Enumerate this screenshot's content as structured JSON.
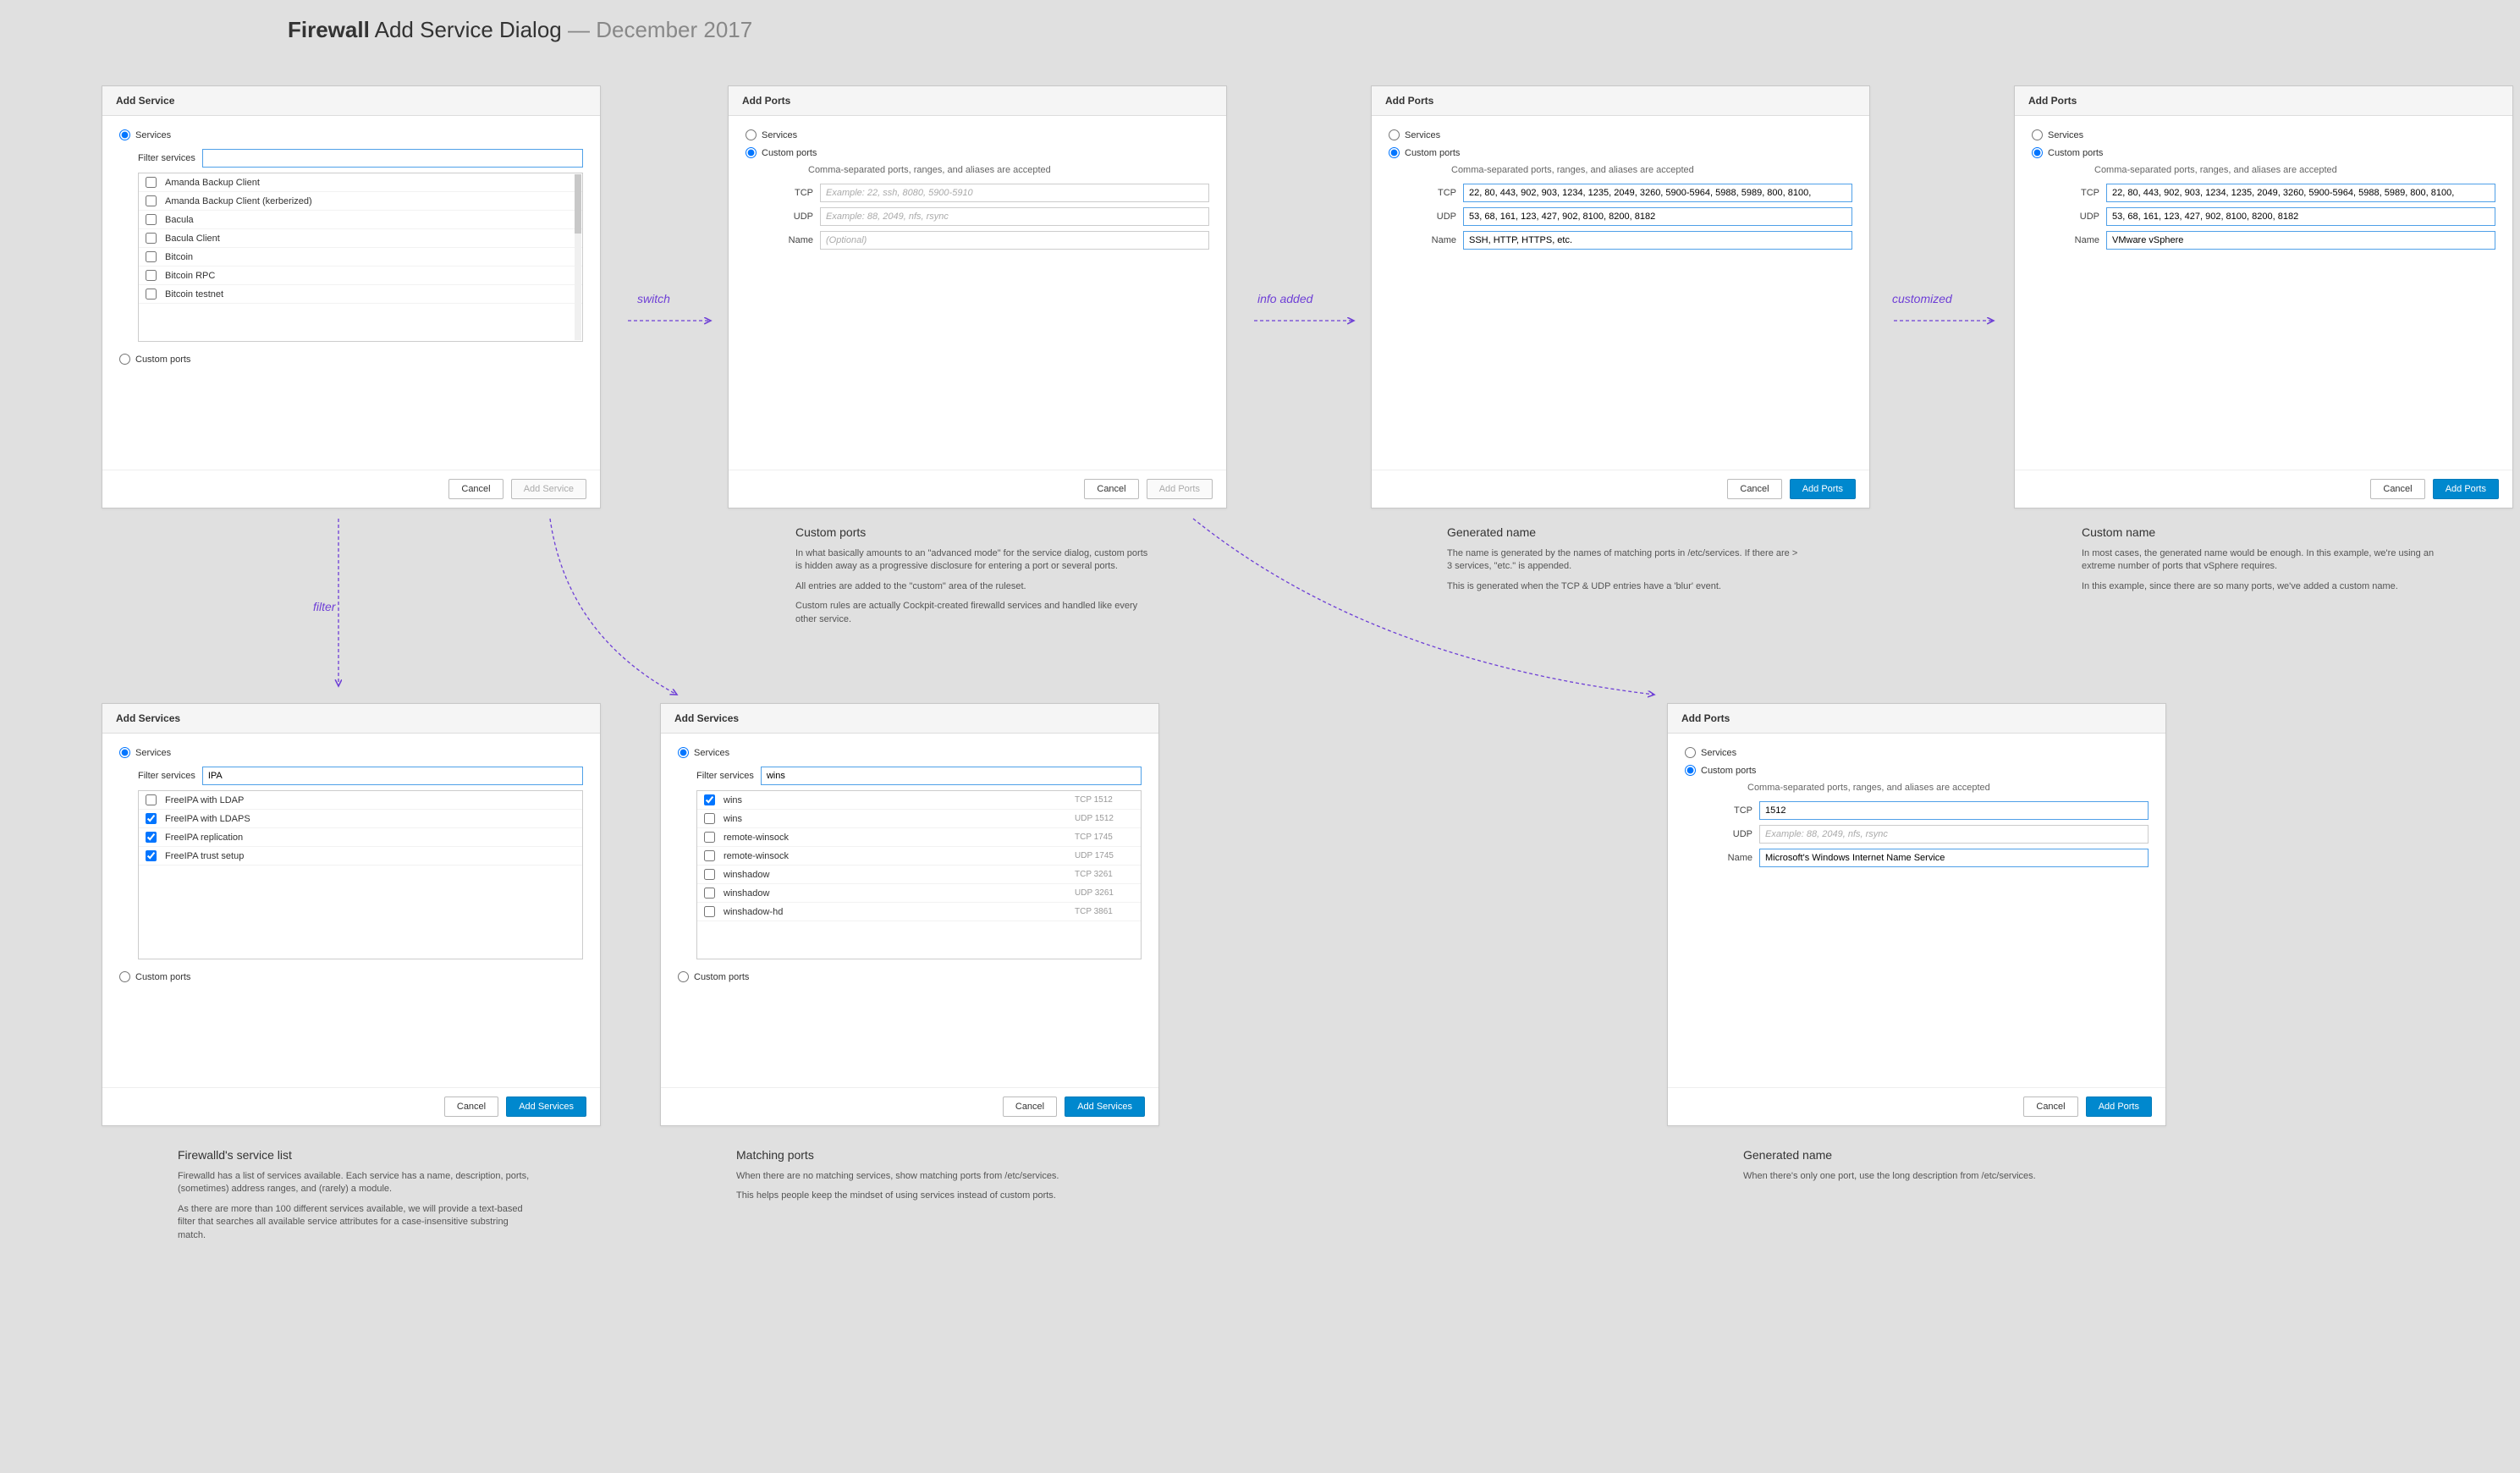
{
  "title_bold": "Firewall",
  "title_rest": "Add Service Dialog",
  "title_date": "December 2017",
  "annotations": {
    "switch": "switch",
    "info_added": "info added",
    "customized": "customized",
    "filter": "filter"
  },
  "labels": {
    "services": "Services",
    "custom_ports": "Custom ports",
    "filter_services": "Filter services",
    "cancel": "Cancel",
    "add_service": "Add Service",
    "add_services": "Add Services",
    "add_ports": "Add Ports",
    "tcp": "TCP",
    "udp": "UDP",
    "name": "Name",
    "ports_hint": "Comma-separated ports, ranges, and aliases are accepted",
    "tcp_ph": "Example: 22, ssh, 8080, 5900-5910",
    "udp_ph": "Example: 88, 2049, nfs, rsync",
    "name_ph": "(Optional)"
  },
  "d1": {
    "title": "Add Service",
    "filter_val": "",
    "items": [
      "Amanda Backup Client",
      "Amanda Backup Client (kerberized)",
      "Bacula",
      "Bacula Client",
      "Bitcoin",
      "Bitcoin RPC",
      "Bitcoin testnet"
    ]
  },
  "d2": {
    "title": "Add Ports",
    "tcp": "",
    "udp": "",
    "name": ""
  },
  "d3": {
    "title": "Add Ports",
    "tcp": "22, 80, 443, 902, 903, 1234, 1235, 2049, 3260, 5900-5964, 5988, 5989, 800, 8100,",
    "udp": "53, 68, 161, 123, 427, 902, 8100, 8200, 8182",
    "name": "SSH, HTTP, HTTPS, etc."
  },
  "d4": {
    "title": "Add Ports",
    "tcp": "22, 80, 443, 902, 903, 1234, 1235, 2049, 3260, 5900-5964, 5988, 5989, 800, 8100,",
    "udp": "53, 68, 161, 123, 427, 902, 8100, 8200, 8182",
    "name": "VMware vSphere"
  },
  "d5": {
    "title": "Add Services",
    "filter_val": "IPA",
    "items": [
      {
        "label": "FreeIPA with LDAP",
        "checked": false
      },
      {
        "label": "FreeIPA with LDAPS",
        "checked": true
      },
      {
        "label": "FreeIPA replication",
        "checked": true
      },
      {
        "label": "FreeIPA trust setup",
        "checked": true
      }
    ]
  },
  "d6": {
    "title": "Add Services",
    "filter_val": "wins",
    "items": [
      {
        "label": "wins",
        "port": "TCP  1512",
        "checked": true
      },
      {
        "label": "wins",
        "port": "UDP 1512",
        "checked": false
      },
      {
        "label": "remote-winsock",
        "port": "TCP  1745",
        "checked": false
      },
      {
        "label": "remote-winsock",
        "port": "UDP 1745",
        "checked": false
      },
      {
        "label": "winshadow",
        "port": "TCP  3261",
        "checked": false
      },
      {
        "label": "winshadow",
        "port": "UDP 3261",
        "checked": false
      },
      {
        "label": "winshadow-hd",
        "port": "TCP  3861",
        "checked": false
      }
    ]
  },
  "d7": {
    "title": "Add Ports",
    "tcp": "1512",
    "udp": "",
    "name": "Microsoft's Windows Internet Name Service"
  },
  "captions": {
    "c2": {
      "h": "Custom ports",
      "p": [
        "In what basically amounts to an \"advanced mode\" for the service dialog, custom ports is hidden away as a progressive disclosure for entering a port or several ports.",
        "All entries are added to the \"custom\" area of the ruleset.",
        "Custom rules are actually Cockpit-created firewalld services and handled like every other service."
      ]
    },
    "c3": {
      "h": "Generated name",
      "p": [
        "The name is generated by the names of matching ports in /etc/services. If there are > 3 services, \"etc.\" is appended.",
        "This is generated when the TCP & UDP entries have a 'blur' event."
      ]
    },
    "c4": {
      "h": "Custom name",
      "p": [
        "In most cases, the generated name would be enough. In this example, we're using an extreme number of ports that vSphere requires.",
        "In this example, since there are so many ports, we've added a custom name."
      ]
    },
    "c5": {
      "h": "Firewalld's service list",
      "p": [
        "Firewalld has a list of services available. Each service has a name, description, ports, (sometimes) address ranges, and (rarely) a module.",
        "As there are more than 100 different services available, we will provide a text-based filter that searches all available service attributes for a case-insensitive substring match."
      ]
    },
    "c6": {
      "h": "Matching ports",
      "p": [
        "When there are no matching services, show matching ports from /etc/services.",
        "This helps people keep the mindset of using services instead of custom ports."
      ]
    },
    "c7": {
      "h": "Generated name",
      "p": [
        "When there's only one port, use the long description from /etc/services."
      ]
    }
  }
}
